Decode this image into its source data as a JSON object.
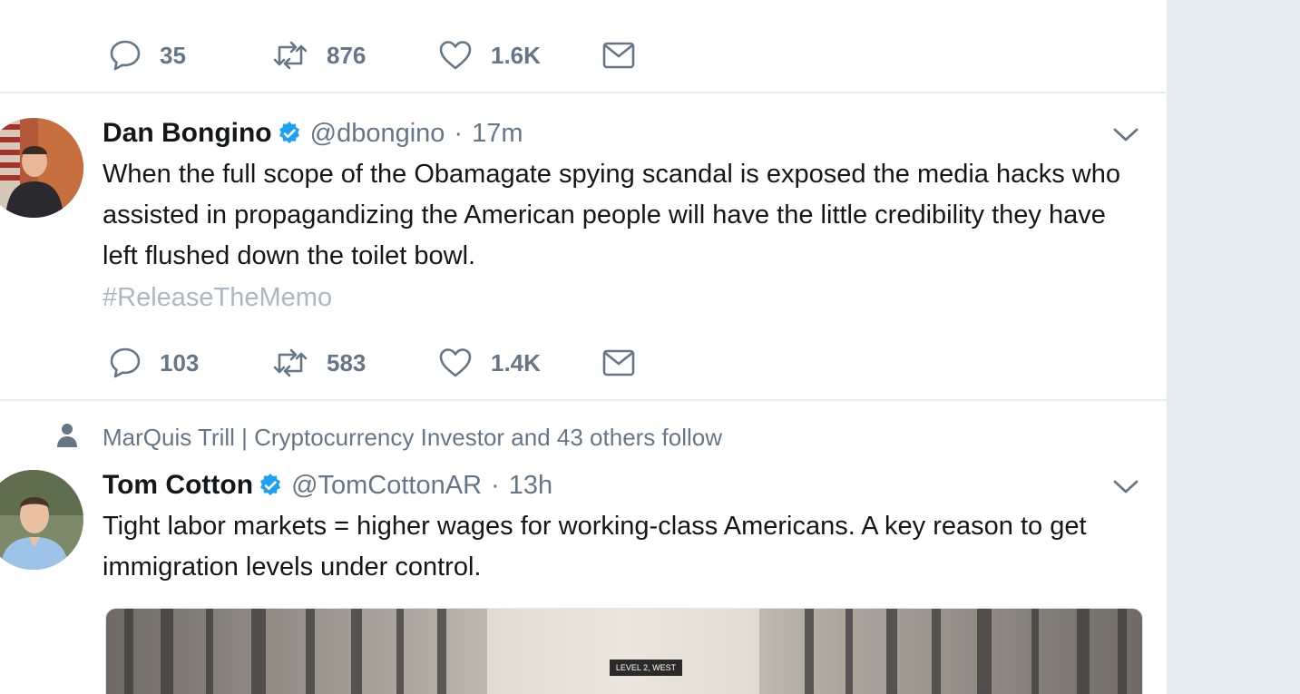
{
  "prev_tweet": {
    "actions": {
      "reply_count": "35",
      "retweet_count": "876",
      "like_count": "1.6K"
    }
  },
  "tweet1": {
    "name": "Dan Bongino",
    "handle": "@dbongino",
    "separator": "·",
    "time": "17m",
    "text": "When the full scope of the Obamagate spying scandal is exposed the media hacks who assisted in propagandizing the American people will have the little credibility they have left flushed down the toilet bowl.",
    "hashtag": "#ReleaseTheMemo",
    "actions": {
      "reply_count": "103",
      "retweet_count": "583",
      "like_count": "1.4K"
    }
  },
  "tweet2": {
    "social_context": "MarQuis Trill | Cryptocurrency Investor and 43 others follow",
    "name": "Tom Cotton",
    "handle": "@TomCottonAR",
    "separator": "·",
    "time": "13h",
    "text": "Tight labor markets = higher wages for working-class Americans. A key reason to get immigration levels under control.",
    "media_sign": "LEVEL 2, WEST"
  },
  "icons": {
    "reply": "reply-icon",
    "retweet": "retweet-icon",
    "like": "heart-icon",
    "dm": "envelope-icon",
    "verified": "verified-badge-icon",
    "chevron": "chevron-down-icon",
    "person": "person-icon"
  },
  "colors": {
    "verified_blue": "#1da1f2",
    "muted_text": "#657786",
    "hashtag_text": "#aab8c2",
    "divider": "#e6ecf0",
    "page_background": "#e6ecf0"
  }
}
